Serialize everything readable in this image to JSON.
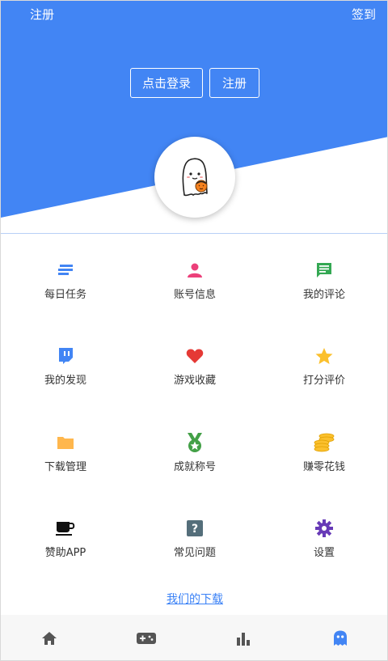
{
  "header": {
    "left_link": "注册",
    "right_link": "签到",
    "login_button": "点击登录",
    "register_button": "注册",
    "bg_color": "#4285f4"
  },
  "grid": {
    "items": [
      {
        "label": "每日任务",
        "icon": "list-lines-icon",
        "color": "#4285f4"
      },
      {
        "label": "账号信息",
        "icon": "person-icon",
        "color": "#ec407a"
      },
      {
        "label": "我的评论",
        "icon": "comment-icon",
        "color": "#34a853"
      },
      {
        "label": "我的发现",
        "icon": "twitch-icon",
        "color": "#4285f4"
      },
      {
        "label": "游戏收藏",
        "icon": "heart-icon",
        "color": "#e53935"
      },
      {
        "label": "打分评价",
        "icon": "star-icon",
        "color": "#fbc02d"
      },
      {
        "label": "下载管理",
        "icon": "folder-icon",
        "color": "#ffb74d"
      },
      {
        "label": "成就称号",
        "icon": "medal-icon",
        "color": "#43a047"
      },
      {
        "label": "赚零花钱",
        "icon": "coins-icon",
        "color": "#fbc02d"
      },
      {
        "label": "赞助APP",
        "icon": "coffee-cup-icon",
        "color": "#111111"
      },
      {
        "label": "常见问题",
        "icon": "help-box-icon",
        "color": "#546e7a"
      },
      {
        "label": "设置",
        "icon": "gear-icon",
        "color": "#673ab7"
      }
    ]
  },
  "download_link": "我们的下载",
  "tabbar": {
    "tabs": [
      {
        "icon": "home-icon",
        "active": false
      },
      {
        "icon": "gamepad-icon",
        "active": false
      },
      {
        "icon": "bar-chart-icon",
        "active": false
      },
      {
        "icon": "ghost-icon",
        "active": true
      }
    ],
    "active_color": "#4285f4",
    "inactive_color": "#555555"
  }
}
